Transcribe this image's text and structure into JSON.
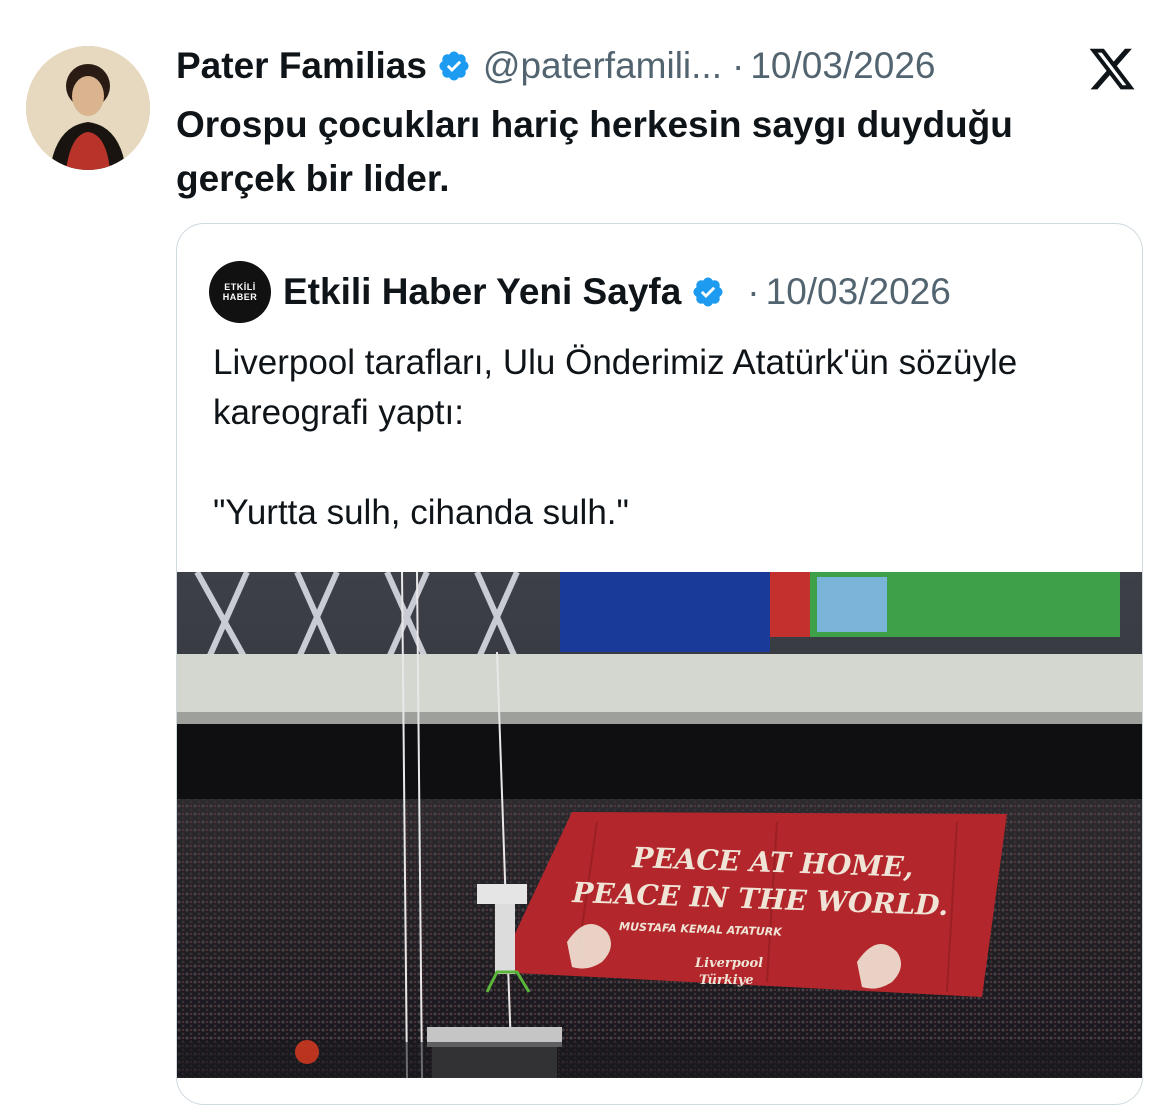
{
  "tweet": {
    "author_name": "Pater Familias",
    "handle": "@paterfamili...",
    "separator": "·",
    "date": "10/03/2026",
    "text": "Orospu çocukları hariç herkesin saygı duyduğu gerçek bir lider."
  },
  "quoted": {
    "avatar_text_top": "ETKİLİ",
    "avatar_text_bottom": "HABER",
    "author_name": "Etkili Haber Yeni Sayfa",
    "separator": "·",
    "date": "10/03/2026",
    "text": "Liverpool tarafları, Ulu Önderimiz Atatürk'ün sözüyle kareografi yaptı:\n\n\"Yurtta sulh, cihanda sulh.\"",
    "image": {
      "banner_line1": "PEACE AT HOME,",
      "banner_line2": "PEACE IN THE WORLD.",
      "banner_line3": "MUSTAFA KEMAL ATATURK",
      "banner_line4": "Liverpool",
      "banner_line5": "Türkiye"
    }
  },
  "colors": {
    "verified_blue": "#1d9bf0",
    "secondary_text": "#536471",
    "banner_red": "#b3262b"
  },
  "icons": {
    "verified": "verified-badge-icon",
    "platform": "x-logo-icon"
  }
}
